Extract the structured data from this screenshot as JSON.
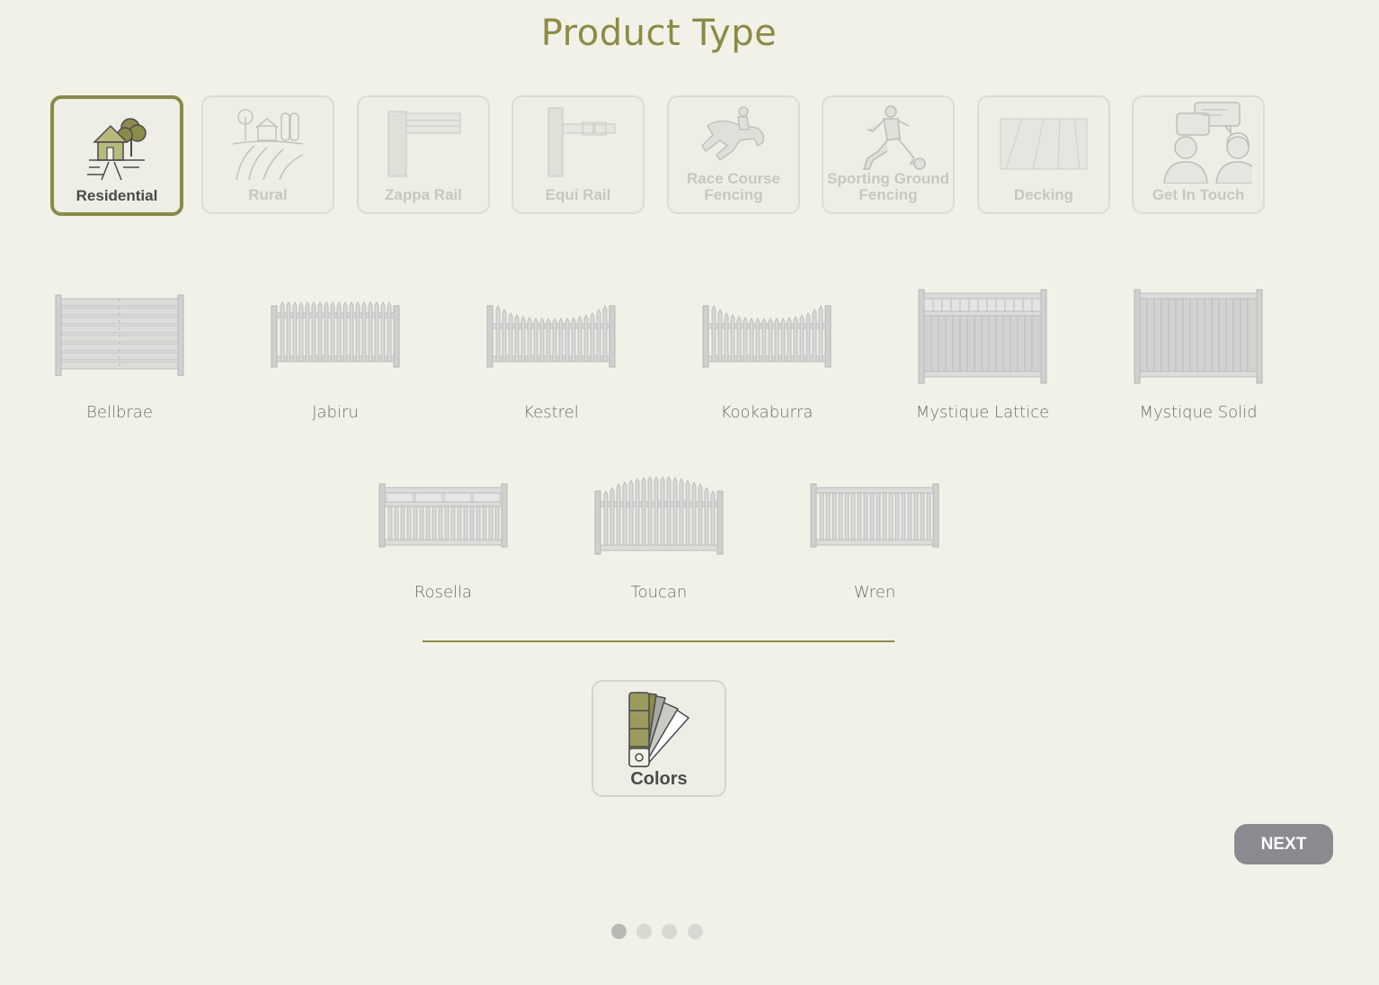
{
  "page": {
    "title": "Product Type"
  },
  "product_types": [
    {
      "label": "Residential",
      "icon": "house-icon",
      "active": true
    },
    {
      "label": "Rural",
      "icon": "farm-icon",
      "active": false
    },
    {
      "label": "Zappa Rail",
      "icon": "zappa-rail-icon",
      "active": false
    },
    {
      "label": "Equi Rail",
      "icon": "equi-rail-icon",
      "active": false
    },
    {
      "label": "Race Course Fencing",
      "icon": "horse-jockey-icon",
      "active": false
    },
    {
      "label": "Sporting Ground Fencing",
      "icon": "soccer-player-icon",
      "active": false
    },
    {
      "label": "Decking",
      "icon": "decking-icon",
      "active": false
    },
    {
      "label": "Get In Touch",
      "icon": "contact-support-icon",
      "active": false
    }
  ],
  "styles": [
    {
      "name": "Bellbrae"
    },
    {
      "name": "Jabiru"
    },
    {
      "name": "Kestrel"
    },
    {
      "name": "Kookaburra"
    },
    {
      "name": "Mystique Lattice"
    },
    {
      "name": "Mystique Solid"
    },
    {
      "name": "Rosella"
    },
    {
      "name": "Toucan"
    },
    {
      "name": "Wren"
    }
  ],
  "colors": {
    "label": "Colors",
    "icon": "color-swatch-icon",
    "swatches": [
      "#9c9a5e",
      "#8d8b4a",
      "#a7a9a6",
      "#c9cac4",
      "#ffffff"
    ]
  },
  "next": {
    "label": "NEXT"
  },
  "pagination": {
    "pages": 4,
    "current": 1
  },
  "theme": {
    "accent": "#8c8a45",
    "active_border": "#8a8a47",
    "button": "#8a8a90"
  }
}
